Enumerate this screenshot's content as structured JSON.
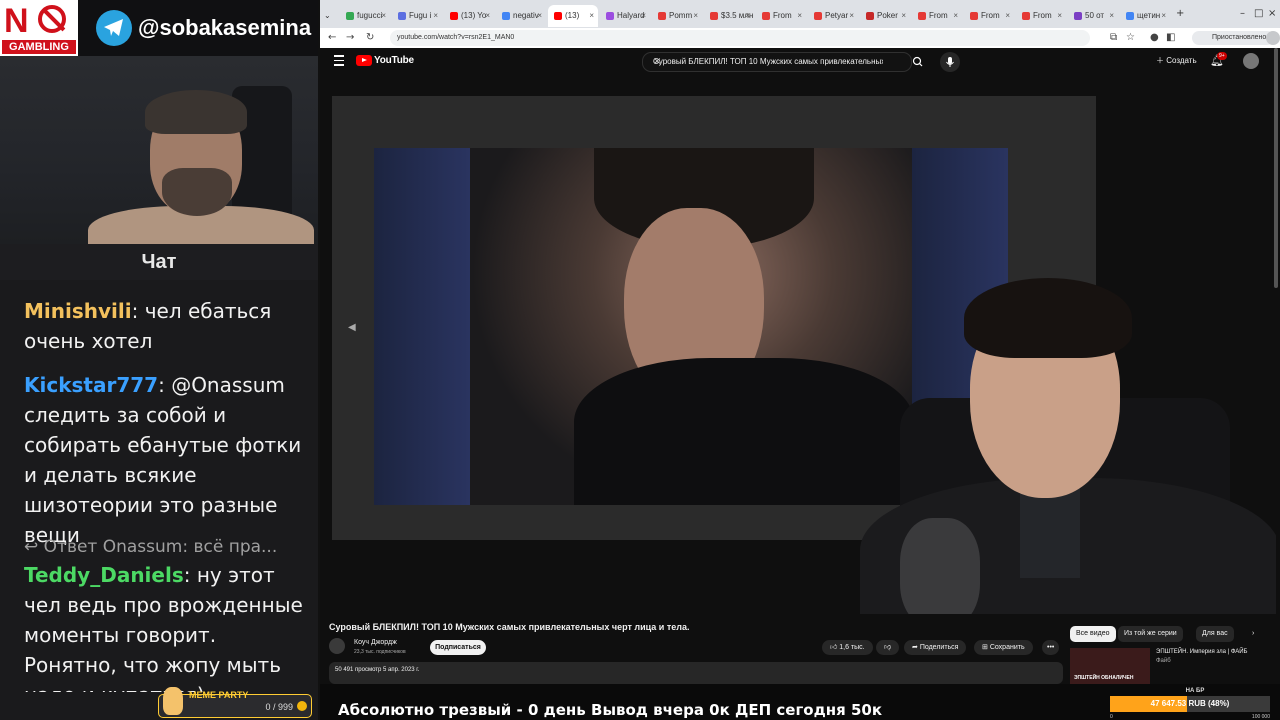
{
  "overlay": {
    "no_gambling": {
      "no": "N",
      "gambling": "GAMBLING"
    },
    "telegram_handle": "@sobakasemina",
    "chat_title": "Чат",
    "messages": [
      {
        "user": "Minishvili",
        "color": "#f3c15d",
        "text": ": чел ебаться очень хотел"
      },
      {
        "user": "Kickstar777",
        "color": "#3aa0ff",
        "text": ": @Onassum следить за собой и собирать ебанутые фотки и делать всякие шизотеории это разные вещи"
      },
      {
        "user": "Teddy_Daniels",
        "color": "#4cd964",
        "text": ": ну этот чел ведь про врожденные моменты говорит. Ронятно, что жопу мыть надо и купаться)"
      }
    ],
    "reply": "Ответ Onassum: всё пра...",
    "meme_party": {
      "label": "MEME PARTY",
      "count": "0 / 999"
    }
  },
  "browser": {
    "tabs": [
      "fugucci",
      "Fugu i",
      "(13) Yo",
      "negativ",
      "(13)",
      "Halyard",
      "Pomm",
      "$3.5 млн",
      "From",
      "Petyar",
      "Poker",
      "From",
      "From",
      "From",
      "50 от",
      "щетин"
    ],
    "url": "youtube.com/watch?v=rsn2E1_MAN0",
    "paused_label": "Приостановлено"
  },
  "youtube": {
    "logo_text": "YouTube",
    "search_query": "Суровый БЛЕКПИЛ! ТОП 10 Мужских самых привлекательных",
    "create_label": "Создать",
    "notif_badge": "9+",
    "video_title": "Суровый БЛЕКПИЛ! ТОП 10 Мужских самых привлекательных черт лица и тела.",
    "channel_name": "Коуч Джордж",
    "channel_subs": "23,3 тыс. подписчиков",
    "subscribe_label": "Подписаться",
    "likes": "1,6 тыс.",
    "share_label": "Поделиться",
    "save_label": "Сохранить",
    "more_label": "•••",
    "views_date": "50 491 просмотр  5 апр. 2023 г.",
    "chips": [
      "Все видео",
      "Из той же серии",
      "Для вас"
    ],
    "rec_thumb_text": "ЭПШТЕЙН ОБНАЛИЧЕН",
    "rec_title": "ЭПШТЕЙН. Империя зла | ФАЙБ",
    "rec_channel": "Файб"
  },
  "ticker": {
    "text": "Абсолютно трезвый - 0 день       Вывод вчера 0к  ДЕП сегодня 50к"
  },
  "goal": {
    "caption": "НА БР",
    "amount": "47 647.53 RUB (48%)",
    "progress": 0.48,
    "min": "0",
    "max": "100 000"
  },
  "colors": {
    "youtube_red": "#ff0000",
    "goal_orange": "#ffa31a",
    "telegram_blue": "#2aa3df"
  }
}
